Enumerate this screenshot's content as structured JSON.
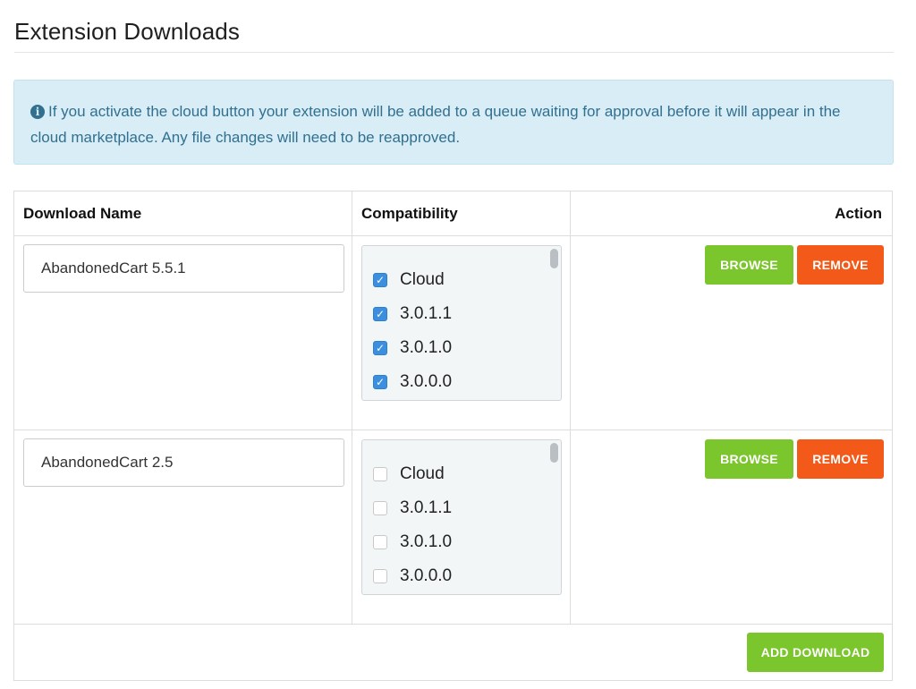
{
  "page": {
    "title": "Extension Downloads"
  },
  "alert": {
    "icon": "info-circle-icon",
    "text": "If you activate the cloud button your extension will be added to a queue waiting for approval before it will appear in the cloud marketplace. Any file changes will need to be reapproved."
  },
  "table": {
    "headers": {
      "name": "Download Name",
      "compatibility": "Compatibility",
      "action": "Action"
    },
    "rows": [
      {
        "name": "AbandonedCart 5.5.1",
        "compat": [
          {
            "label": "Cloud",
            "checked": true
          },
          {
            "label": "3.0.1.1",
            "checked": true
          },
          {
            "label": "3.0.1.0",
            "checked": true
          },
          {
            "label": "3.0.0.0",
            "checked": true
          }
        ],
        "browse_label": "BROWSE",
        "remove_label": "REMOVE"
      },
      {
        "name": "AbandonedCart 2.5",
        "compat": [
          {
            "label": "Cloud",
            "checked": false
          },
          {
            "label": "3.0.1.1",
            "checked": false
          },
          {
            "label": "3.0.1.0",
            "checked": false
          },
          {
            "label": "3.0.0.0",
            "checked": false
          }
        ],
        "browse_label": "BROWSE",
        "remove_label": "REMOVE"
      }
    ],
    "add_label": "ADD DOWNLOAD"
  },
  "colors": {
    "alert_bg": "#d9edf7",
    "alert_text": "#31708f",
    "button_green": "#7bc52d",
    "button_orange": "#f35a1a",
    "checkbox_checked": "#3b8fde"
  }
}
